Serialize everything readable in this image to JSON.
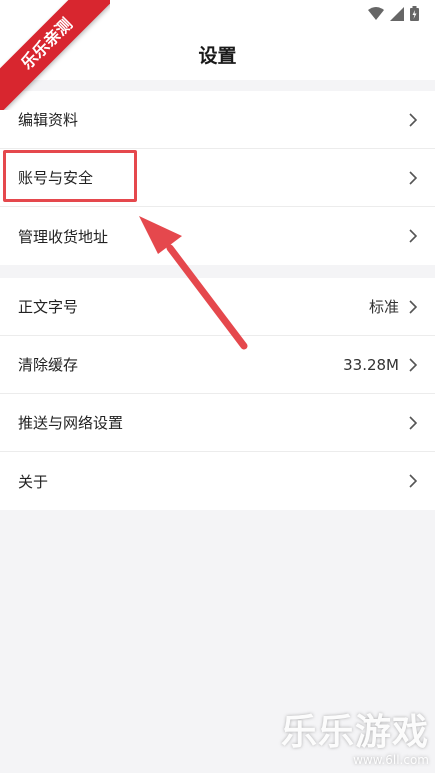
{
  "header": {
    "title": "设置"
  },
  "groups": [
    {
      "items": [
        {
          "label": "编辑资料"
        },
        {
          "label": "账号与安全"
        },
        {
          "label": "管理收货地址"
        }
      ]
    },
    {
      "items": [
        {
          "label": "正文字号",
          "value": "标准"
        },
        {
          "label": "清除缓存",
          "value": "33.28M"
        },
        {
          "label": "推送与网络设置"
        },
        {
          "label": "关于"
        }
      ]
    }
  ],
  "overlay": {
    "ribbon_text": "乐乐亲测",
    "watermark_main": "乐乐游戏",
    "watermark_sub": "www.6ll.com",
    "highlight_color": "#e5484d"
  },
  "icons": [
    "wifi-icon",
    "signal-icon",
    "battery-icon",
    "chevron-right-icon"
  ]
}
